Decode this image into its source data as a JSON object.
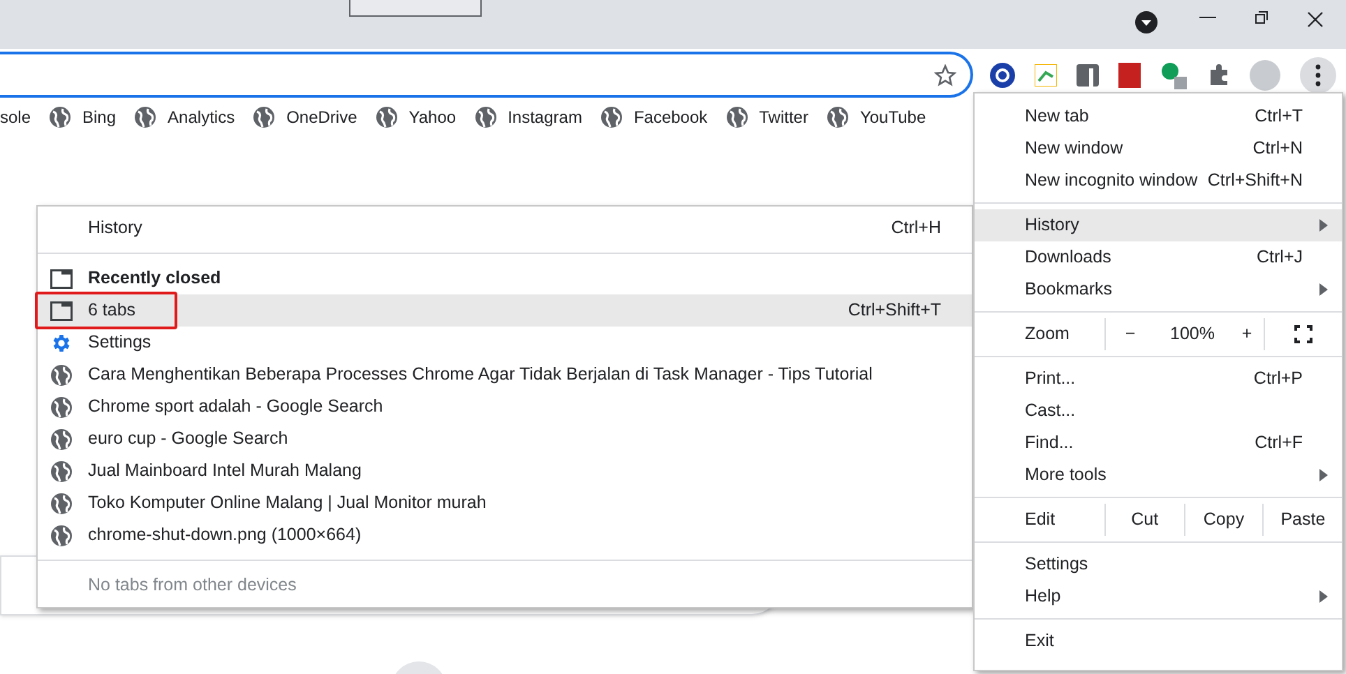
{
  "bookmarks": [
    {
      "label": "sole",
      "icon": false
    },
    {
      "label": "Bing",
      "icon": true
    },
    {
      "label": "Analytics",
      "icon": true
    },
    {
      "label": "OneDrive",
      "icon": true
    },
    {
      "label": "Yahoo",
      "icon": true
    },
    {
      "label": "Instagram",
      "icon": true
    },
    {
      "label": "Facebook",
      "icon": true
    },
    {
      "label": "Twitter",
      "icon": true
    },
    {
      "label": "YouTube",
      "icon": true
    }
  ],
  "history_submenu": {
    "sections": [
      [
        {
          "kind": "item",
          "label": "History",
          "shortcut": "Ctrl+H",
          "selected": false
        }
      ],
      [
        {
          "kind": "heading",
          "label": "Recently closed",
          "selected": false
        },
        {
          "kind": "tabs",
          "label": "6 tabs",
          "shortcut": "Ctrl+Shift+T",
          "selected": true,
          "annotated": true
        },
        {
          "kind": "settings",
          "label": "Settings",
          "selected": false
        },
        {
          "kind": "page",
          "label": "Cara Menghentikan Beberapa Processes Chrome Agar Tidak Berjalan di Task Manager - Tips  Tutorial",
          "selected": false
        },
        {
          "kind": "page",
          "label": "Chrome sport adalah - Google Search",
          "selected": false
        },
        {
          "kind": "page",
          "label": "euro cup - Google Search",
          "selected": false
        },
        {
          "kind": "page",
          "label": "Jual Mainboard Intel Murah Malang",
          "selected": false
        },
        {
          "kind": "page",
          "label": "Toko Komputer Online Malang | Jual Monitor murah",
          "selected": false
        },
        {
          "kind": "page",
          "label": "chrome-shut-down.png (1000×664)",
          "selected": false
        }
      ],
      [
        {
          "kind": "disabled",
          "label": "No tabs from other devices",
          "selected": false
        }
      ]
    ]
  },
  "main_menu": {
    "sections": [
      [
        {
          "kind": "item",
          "label": "New tab",
          "shortcut": "Ctrl+T",
          "submenu": false,
          "selected": false
        },
        {
          "kind": "item",
          "label": "New window",
          "shortcut": "Ctrl+N",
          "submenu": false,
          "selected": false
        },
        {
          "kind": "item",
          "label": "New incognito window",
          "shortcut": "Ctrl+Shift+N",
          "submenu": false,
          "selected": false
        }
      ],
      [
        {
          "kind": "item",
          "label": "History",
          "submenu": true,
          "selected": true
        },
        {
          "kind": "item",
          "label": "Downloads",
          "shortcut": "Ctrl+J",
          "submenu": false,
          "selected": false
        },
        {
          "kind": "item",
          "label": "Bookmarks",
          "submenu": true,
          "selected": false
        }
      ],
      [
        {
          "kind": "zoom",
          "label": "Zoom",
          "minus": "−",
          "value": "100%",
          "plus": "+"
        }
      ],
      [
        {
          "kind": "item",
          "label": "Print...",
          "shortcut": "Ctrl+P",
          "submenu": false,
          "selected": false
        },
        {
          "kind": "item",
          "label": "Cast...",
          "submenu": false,
          "selected": false
        },
        {
          "kind": "item",
          "label": "Find...",
          "shortcut": "Ctrl+F",
          "submenu": false,
          "selected": false
        },
        {
          "kind": "item",
          "label": "More tools",
          "submenu": true,
          "selected": false
        }
      ],
      [
        {
          "kind": "edit",
          "label": "Edit",
          "buttons": [
            "Cut",
            "Copy",
            "Paste"
          ]
        }
      ],
      [
        {
          "kind": "item",
          "label": "Settings",
          "submenu": false,
          "selected": false
        },
        {
          "kind": "item",
          "label": "Help",
          "submenu": true,
          "selected": false
        }
      ],
      [
        {
          "kind": "item",
          "label": "Exit",
          "submenu": false,
          "selected": false
        }
      ]
    ]
  }
}
